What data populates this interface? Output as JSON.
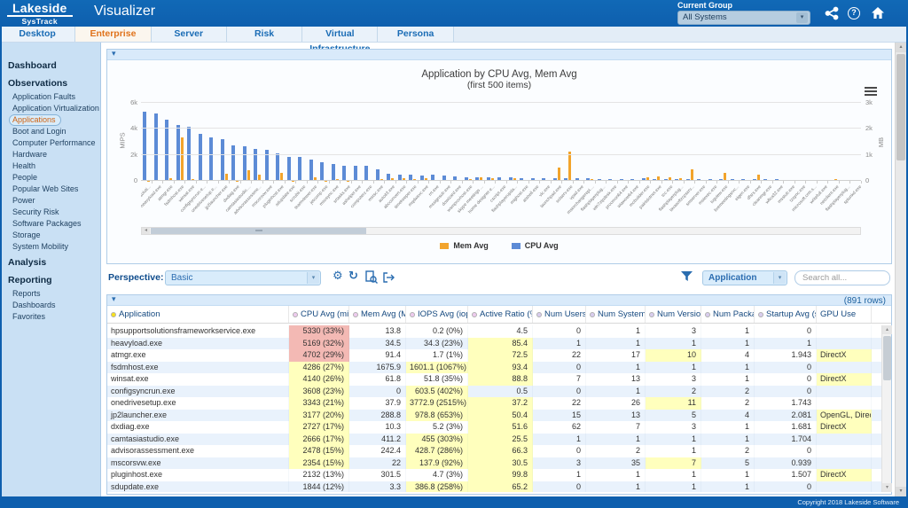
{
  "header": {
    "logo_title": "Lakeside",
    "logo_subtitle": "SysTrack",
    "app_title": "Visualizer",
    "current_group_label": "Current Group",
    "current_group_value": "All Systems"
  },
  "tabs": [
    {
      "label": "Desktop",
      "active": false
    },
    {
      "label": "Enterprise",
      "active": true
    },
    {
      "label": "Server",
      "active": false
    },
    {
      "label": "Risk",
      "active": false
    },
    {
      "label": "Virtual Infrastructure",
      "active": false
    },
    {
      "label": "Persona",
      "active": false
    }
  ],
  "sidebar": {
    "sections": [
      {
        "title": "Dashboard",
        "items": []
      },
      {
        "title": "Observations",
        "items": [
          "Application Faults",
          "Application Virtualization",
          "Applications",
          "Boot and Login",
          "Computer Performance",
          "Hardware",
          "Health",
          "People",
          "Popular Web Sites",
          "Power",
          "Security Risk",
          "Software Packages",
          "Storage",
          "System Mobility"
        ]
      },
      {
        "title": "Analysis",
        "items": []
      },
      {
        "title": "Reporting",
        "items": [
          "Reports",
          "Dashboards",
          "Favorites"
        ]
      }
    ],
    "selected_item": "Applications"
  },
  "chart_data": {
    "type": "bar",
    "title": "Application by CPU Avg, Mem Avg",
    "subtitle": "(first 500 items)",
    "left_axis": {
      "label": "MIPS",
      "ticks": [
        "0",
        "2k",
        "4k",
        "6k"
      ],
      "max": 6000
    },
    "right_axis": {
      "label": "MB",
      "ticks": [
        "0",
        "1k",
        "2k",
        "3k"
      ],
      "max": 3000
    },
    "legend": [
      {
        "name": "Mem Avg",
        "color": "#f2a42c"
      },
      {
        "name": "CPU Avg",
        "color": "#5c8bd6"
      }
    ],
    "categories": [
      "hpsupportsolutionsframeworkservice.exe",
      "heavyload.exe",
      "atmgr.exe",
      "fsdmhost.exe",
      "winsat.exe",
      "configsyncrun.exe",
      "onedrivesetup.exe",
      "jp2launcher.exe",
      "dxdiag.exe",
      "camtasiastudio.exe",
      "advisorassessment.exe",
      "mscorsvw.exe",
      "pluginhost.exe",
      "sdupdate.exe",
      "scrubii.exe",
      "teamviewer.exe",
      "jetcomp.exe",
      "msosync.exe",
      "srtasks.exe",
      "ashelper.exe",
      "computerz.exe",
      "mstsc.exe",
      "autoit3.exe",
      "abcconvert.exe",
      "timekeeper.exe",
      "mqdwsvc.exe",
      "rrt.exe",
      "mssignsub.exe",
      "dowizard.exe",
      "wsmprovhost.exe",
      "skype meetings app.exe",
      "home designer.exe",
      "cscript.exe",
      "flashplayerupdater.exe",
      "mighost.exe",
      "atshell.exe",
      "vlc.exe",
      "launchpad.exe",
      "solserv.exe",
      "vpad.exe",
      "msexchangerepl.exe",
      "flashplayerplugin.exe",
      "win7zipdesk.exe",
      "procmon64.exe",
      "wiawow64.exe",
      "mcbuilder.exe",
      "paintdotnet.exe",
      "tcc.exe",
      "flashplayerplugi.exe",
      "lavasoftzcpservice.exe",
      "smserver.exe",
      "msiexec.exe",
      "logview.exe",
      "livemeetingsrvc.exe",
      "eigen.exe",
      "dfsrs.exe",
      "cleanmgr.exe",
      "wfica32.exe",
      "msstub.exe",
      "tzsync.exe",
      "microsoft.crm.se.exe",
      "writefull.exe",
      "netclient.exe",
      "flashplayerplug.exe",
      "splunkd.exe"
    ],
    "series": [
      {
        "name": "CPU Avg",
        "axis": "left",
        "color": "#5c8bd6",
        "values": [
          5330,
          5169,
          4702,
          4286,
          4140,
          3608,
          3343,
          3177,
          2727,
          2666,
          2478,
          2354,
          2132,
          1844,
          1810,
          1640,
          1400,
          1330,
          1160,
          1160,
          1180,
          920,
          520,
          450,
          470,
          430,
          490,
          420,
          330,
          300,
          280,
          290,
          250,
          240,
          230,
          200,
          195,
          210,
          190,
          200,
          230,
          170,
          150,
          160,
          140,
          190,
          160,
          150,
          140,
          155,
          130,
          135,
          140,
          120,
          120,
          115,
          110,
          105,
          100,
          95,
          90,
          85,
          80,
          75,
          70
        ]
      },
      {
        "name": "Mem Avg",
        "axis": "right",
        "color": "#f2a42c",
        "values": [
          13.8,
          34.5,
          91.4,
          1675.9,
          61.8,
          0,
          37.9,
          288.8,
          10.3,
          411.2,
          242.4,
          22,
          301.5,
          3.3,
          45,
          120,
          15,
          60,
          8,
          35,
          20,
          85,
          90,
          110,
          60,
          95,
          25,
          30,
          45,
          55,
          150,
          90,
          30,
          115,
          40,
          25,
          50,
          525,
          1125,
          45,
          70,
          20,
          30,
          40,
          25,
          120,
          185,
          130,
          90,
          450,
          40,
          50,
          300,
          35,
          40,
          225,
          30,
          45,
          25,
          20,
          35,
          30,
          55,
          25,
          40
        ]
      }
    ]
  },
  "toolbar": {
    "perspective_label": "Perspective:",
    "perspective_value": "Basic",
    "filter_value": "Application",
    "search_placeholder": "Search all..."
  },
  "table_panel": {
    "row_count_label": "(891 rows)"
  },
  "table": {
    "columns": [
      {
        "label": "Application",
        "dot": "#f8e11c",
        "sort": false
      },
      {
        "label": "CPU Avg (mips)",
        "dot": "#eecbee",
        "sort": true
      },
      {
        "label": "Mem Avg (MB)",
        "dot": "#eecbee",
        "sort": false
      },
      {
        "label": "IOPS Avg (iops)",
        "dot": "#eecbee",
        "sort": false
      },
      {
        "label": "Active Ratio (%)",
        "dot": "#eecbee",
        "sort": false
      },
      {
        "label": "Num Users",
        "dot": "#d9cdee",
        "sort": false
      },
      {
        "label": "Num Systems",
        "dot": "#d9cdee",
        "sort": false
      },
      {
        "label": "Num Versions",
        "dot": "#d9cdee",
        "sort": false
      },
      {
        "label": "Num Packages",
        "dot": "#d9cdee",
        "sort": false
      },
      {
        "label": "Startup Avg (sec)",
        "dot": "#d9cdee",
        "sort": false
      },
      {
        "label": "GPU Use",
        "dot": "",
        "sort": false
      }
    ],
    "rows": [
      [
        [
          "hpsupportsolutionsframeworkservice.exe",
          ""
        ],
        [
          "5330 (33%)",
          "r"
        ],
        [
          "13.8",
          ""
        ],
        [
          "0.2 (0%)",
          ""
        ],
        [
          "4.5",
          ""
        ],
        [
          "0",
          ""
        ],
        [
          "1",
          ""
        ],
        [
          "3",
          ""
        ],
        [
          "1",
          ""
        ],
        [
          "0",
          ""
        ],
        [
          "",
          ""
        ]
      ],
      [
        [
          "heavyload.exe",
          ""
        ],
        [
          "5169 (32%)",
          "r"
        ],
        [
          "34.5",
          ""
        ],
        [
          "34.3 (23%)",
          ""
        ],
        [
          "85.4",
          "y"
        ],
        [
          "1",
          ""
        ],
        [
          "1",
          ""
        ],
        [
          "1",
          ""
        ],
        [
          "1",
          ""
        ],
        [
          "1",
          ""
        ],
        [
          "",
          ""
        ]
      ],
      [
        [
          "atmgr.exe",
          ""
        ],
        [
          "4702 (29%)",
          "r"
        ],
        [
          "91.4",
          ""
        ],
        [
          "1.7 (1%)",
          ""
        ],
        [
          "72.5",
          "y"
        ],
        [
          "22",
          ""
        ],
        [
          "17",
          ""
        ],
        [
          "10",
          "y"
        ],
        [
          "4",
          ""
        ],
        [
          "1.943",
          ""
        ],
        [
          "DirectX",
          "y"
        ]
      ],
      [
        [
          "fsdmhost.exe",
          ""
        ],
        [
          "4286 (27%)",
          "y"
        ],
        [
          "1675.9",
          ""
        ],
        [
          "1601.1 (1067%)",
          "y"
        ],
        [
          "93.4",
          "y"
        ],
        [
          "0",
          ""
        ],
        [
          "1",
          ""
        ],
        [
          "1",
          ""
        ],
        [
          "1",
          ""
        ],
        [
          "0",
          ""
        ],
        [
          "",
          ""
        ]
      ],
      [
        [
          "winsat.exe",
          ""
        ],
        [
          "4140 (26%)",
          "y"
        ],
        [
          "61.8",
          ""
        ],
        [
          "51.8 (35%)",
          ""
        ],
        [
          "88.8",
          "y"
        ],
        [
          "7",
          ""
        ],
        [
          "13",
          ""
        ],
        [
          "3",
          ""
        ],
        [
          "1",
          ""
        ],
        [
          "0",
          ""
        ],
        [
          "DirectX",
          "y"
        ]
      ],
      [
        [
          "configsyncrun.exe",
          ""
        ],
        [
          "3608 (23%)",
          "y"
        ],
        [
          "0",
          ""
        ],
        [
          "603.5 (402%)",
          "y"
        ],
        [
          "0.5",
          ""
        ],
        [
          "0",
          ""
        ],
        [
          "1",
          ""
        ],
        [
          "2",
          ""
        ],
        [
          "2",
          ""
        ],
        [
          "0",
          ""
        ],
        [
          "",
          ""
        ]
      ],
      [
        [
          "onedrivesetup.exe",
          ""
        ],
        [
          "3343 (21%)",
          "y"
        ],
        [
          "37.9",
          ""
        ],
        [
          "3772.9 (2515%)",
          "y"
        ],
        [
          "37.2",
          "y"
        ],
        [
          "22",
          ""
        ],
        [
          "26",
          ""
        ],
        [
          "11",
          "y"
        ],
        [
          "2",
          ""
        ],
        [
          "1.743",
          ""
        ],
        [
          "",
          ""
        ]
      ],
      [
        [
          "jp2launcher.exe",
          ""
        ],
        [
          "3177 (20%)",
          "y"
        ],
        [
          "288.8",
          ""
        ],
        [
          "978.8 (653%)",
          "y"
        ],
        [
          "50.4",
          "y"
        ],
        [
          "15",
          ""
        ],
        [
          "13",
          ""
        ],
        [
          "5",
          ""
        ],
        [
          "4",
          ""
        ],
        [
          "2.081",
          ""
        ],
        [
          "OpenGL, DirectX",
          "y"
        ]
      ],
      [
        [
          "dxdiag.exe",
          ""
        ],
        [
          "2727 (17%)",
          "y"
        ],
        [
          "10.3",
          ""
        ],
        [
          "5.2 (3%)",
          ""
        ],
        [
          "51.6",
          "y"
        ],
        [
          "62",
          ""
        ],
        [
          "7",
          ""
        ],
        [
          "3",
          ""
        ],
        [
          "1",
          ""
        ],
        [
          "1.681",
          ""
        ],
        [
          "DirectX",
          "y"
        ]
      ],
      [
        [
          "camtasiastudio.exe",
          ""
        ],
        [
          "2666 (17%)",
          "y"
        ],
        [
          "411.2",
          ""
        ],
        [
          "455 (303%)",
          "y"
        ],
        [
          "25.5",
          "y"
        ],
        [
          "1",
          ""
        ],
        [
          "1",
          ""
        ],
        [
          "1",
          ""
        ],
        [
          "1",
          ""
        ],
        [
          "1.704",
          ""
        ],
        [
          "",
          ""
        ]
      ],
      [
        [
          "advisorassessment.exe",
          ""
        ],
        [
          "2478 (15%)",
          "y"
        ],
        [
          "242.4",
          ""
        ],
        [
          "428.7 (286%)",
          "y"
        ],
        [
          "66.3",
          "y"
        ],
        [
          "0",
          ""
        ],
        [
          "2",
          ""
        ],
        [
          "1",
          ""
        ],
        [
          "2",
          ""
        ],
        [
          "0",
          ""
        ],
        [
          "",
          ""
        ]
      ],
      [
        [
          "mscorsvw.exe",
          ""
        ],
        [
          "2354 (15%)",
          "y"
        ],
        [
          "22",
          ""
        ],
        [
          "137.9 (92%)",
          "y"
        ],
        [
          "30.5",
          "y"
        ],
        [
          "3",
          ""
        ],
        [
          "35",
          ""
        ],
        [
          "7",
          "y"
        ],
        [
          "5",
          ""
        ],
        [
          "0.939",
          ""
        ],
        [
          "",
          ""
        ]
      ],
      [
        [
          "pluginhost.exe",
          ""
        ],
        [
          "2132 (13%)",
          ""
        ],
        [
          "301.5",
          ""
        ],
        [
          "4.7 (3%)",
          ""
        ],
        [
          "99.8",
          "y"
        ],
        [
          "1",
          ""
        ],
        [
          "1",
          ""
        ],
        [
          "1",
          ""
        ],
        [
          "1",
          ""
        ],
        [
          "1.507",
          ""
        ],
        [
          "DirectX",
          "y"
        ]
      ],
      [
        [
          "sdupdate.exe",
          ""
        ],
        [
          "1844 (12%)",
          ""
        ],
        [
          "3.3",
          ""
        ],
        [
          "386.8 (258%)",
          "y"
        ],
        [
          "65.2",
          "y"
        ],
        [
          "0",
          ""
        ],
        [
          "1",
          ""
        ],
        [
          "1",
          ""
        ],
        [
          "1",
          ""
        ],
        [
          "0",
          ""
        ],
        [
          "",
          ""
        ]
      ]
    ]
  },
  "footer": {
    "copyright": "Copyright 2018 Lakeside Software"
  }
}
